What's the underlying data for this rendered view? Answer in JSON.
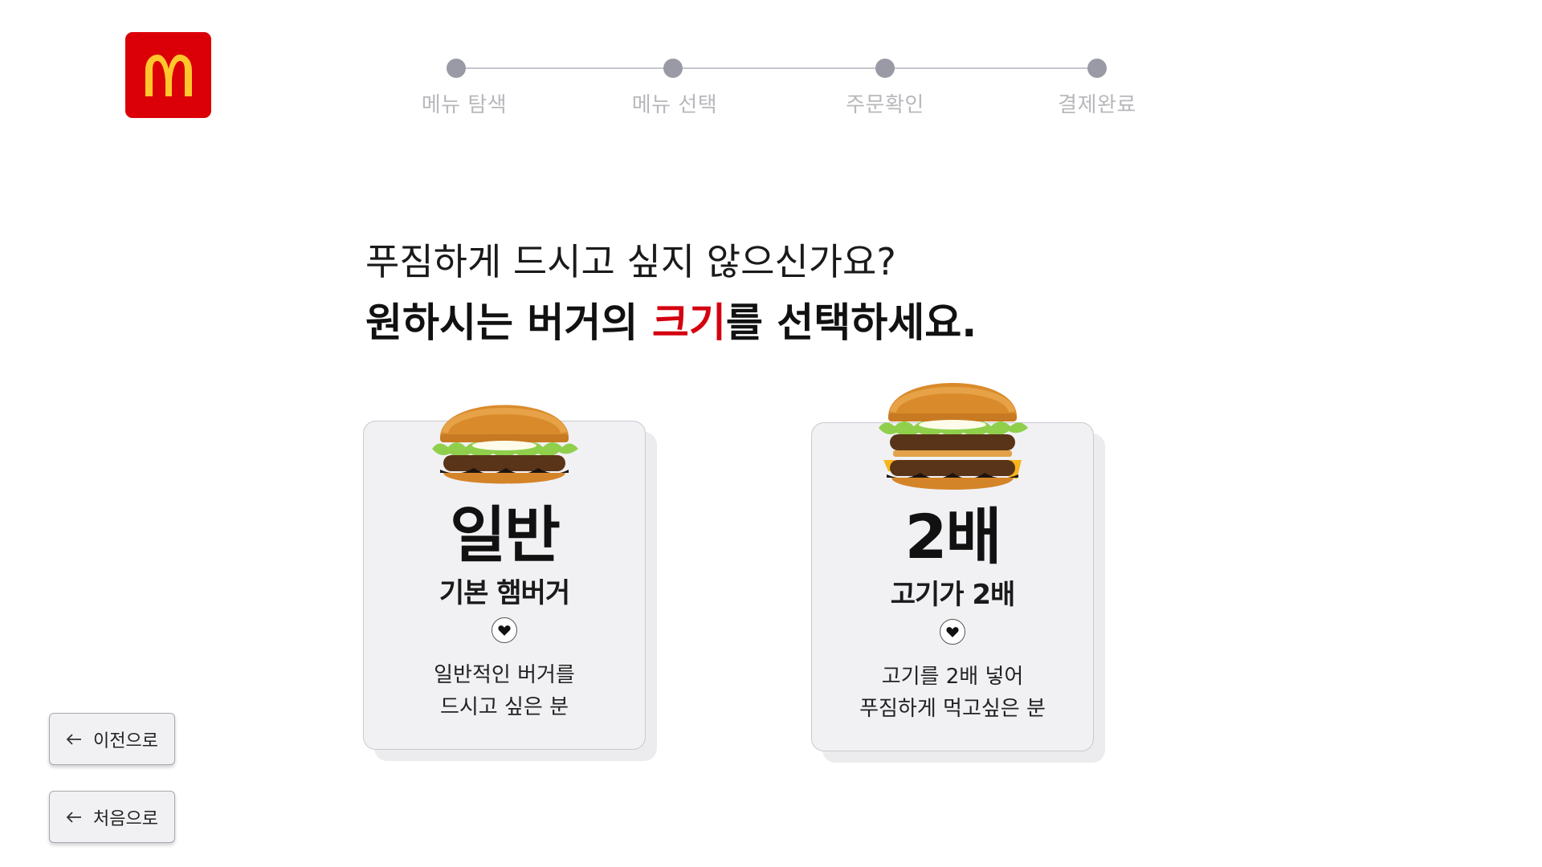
{
  "brand": {
    "logo_color": "#db0007",
    "logo_arch_color": "#ffc72c"
  },
  "stepper": {
    "steps": [
      {
        "label": "메뉴 탐색"
      },
      {
        "label": "메뉴 선택"
      },
      {
        "label": "주문확인"
      },
      {
        "label": "결제완료"
      }
    ]
  },
  "question": {
    "line1": "푸짐하게 드시고 싶지 않으신가요?",
    "line2_pre": "원하시는 버거의 ",
    "line2_highlight": "크기",
    "line2_post": "를 선택하세요.",
    "highlight_color": "#d4000f"
  },
  "options": [
    {
      "size": "일반",
      "name": "기본 햄버거",
      "icon": "heart-icon",
      "desc_line1": "일반적인 버거를",
      "desc_line2": "드시고 싶은 분"
    },
    {
      "size": "2배",
      "name": "고기가 2배",
      "icon": "heart-icon",
      "desc_line1": "고기를 2배 넣어",
      "desc_line2": "푸짐하게 먹고싶은 분"
    }
  ],
  "nav": {
    "back_label": "이전으로",
    "home_label": "처음으로",
    "icon": "arrow-left-icon"
  }
}
